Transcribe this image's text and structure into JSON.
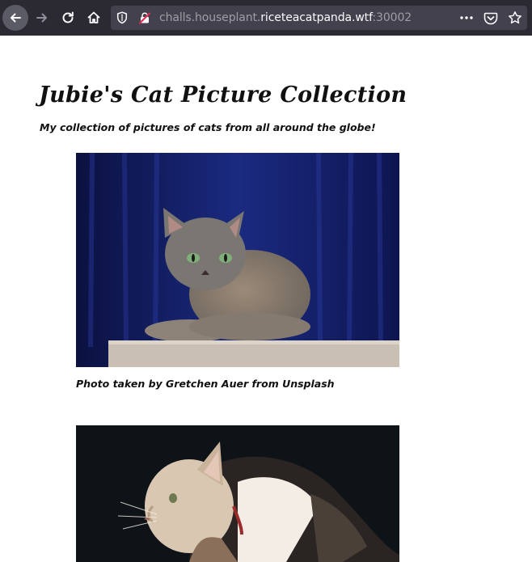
{
  "browser": {
    "url": {
      "scheme_prefix": "challs.houseplant.",
      "host": "riceteacatpanda.wtf",
      "port_suffix": ":30002"
    },
    "icons": {
      "back": "back-arrow-icon",
      "forward": "forward-arrow-icon",
      "reload": "reload-icon",
      "home": "home-icon",
      "tracking": "shield-icon",
      "security": "insecure-lock-icon",
      "menu": "more-icon",
      "pocket": "pocket-icon",
      "bookmark": "star-icon"
    },
    "colors": {
      "toolbar": "#2b2a33",
      "urlbar": "#42414d"
    }
  },
  "page": {
    "title": "Jubie's Cat Picture Collection",
    "subtitle": "My collection of pictures of cats from all around the globe!",
    "photos": [
      {
        "caption": "Photo taken by Gretchen Auer from Unsplash"
      },
      {}
    ]
  }
}
